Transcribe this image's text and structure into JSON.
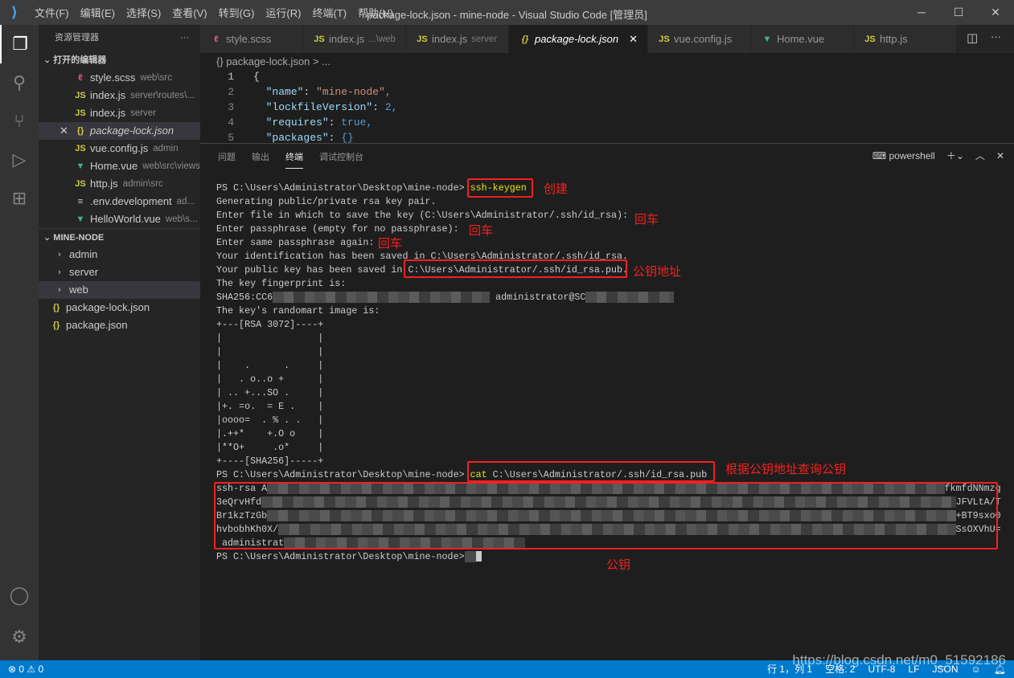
{
  "window": {
    "title": "package-lock.json - mine-node - Visual Studio Code [管理员]",
    "logo": "vscode-logo",
    "minimize": "─",
    "maximize": "☐",
    "close": "✕"
  },
  "menu": [
    "文件(F)",
    "编辑(E)",
    "选择(S)",
    "查看(V)",
    "转到(G)",
    "运行(R)",
    "终端(T)",
    "帮助(H)"
  ],
  "activity": [
    "files-icon",
    "search-icon",
    "source-control-icon",
    "run-debug-icon",
    "extensions-icon",
    "account-icon",
    "settings-gear-icon"
  ],
  "sidebar": {
    "title": "资源管理器",
    "more": "···",
    "open_editors_label": "打开的编辑器",
    "open_editors": [
      {
        "icon": "scss",
        "name": "style.scss",
        "desc": "web\\src"
      },
      {
        "icon": "js",
        "name": "index.js",
        "desc": "server\\routes\\..."
      },
      {
        "icon": "js",
        "name": "index.js",
        "desc": "server"
      },
      {
        "icon": "json",
        "name": "package-lock.json",
        "desc": "",
        "active": true
      },
      {
        "icon": "js",
        "name": "vue.config.js",
        "desc": "admin"
      },
      {
        "icon": "vue",
        "name": "Home.vue",
        "desc": "web\\src\\views"
      },
      {
        "icon": "js",
        "name": "http.js",
        "desc": "admin\\src"
      },
      {
        "icon": "text",
        "name": ".env.development",
        "desc": "ad..."
      },
      {
        "icon": "vue",
        "name": "HelloWorld.vue",
        "desc": "web\\s..."
      }
    ],
    "project_label": "MINE-NODE",
    "tree": [
      {
        "name": "admin",
        "folder": true
      },
      {
        "name": "server",
        "folder": true
      },
      {
        "name": "web",
        "folder": true,
        "selected": true
      },
      {
        "name": "package-lock.json"
      },
      {
        "name": "package.json"
      }
    ]
  },
  "tabs": [
    {
      "icon": "scss",
      "name": "style.scss",
      "desc": ""
    },
    {
      "icon": "js",
      "name": "index.js",
      "desc": "...\\web"
    },
    {
      "icon": "js",
      "name": "index.js",
      "desc": "server"
    },
    {
      "icon": "json",
      "name": "package-lock.json",
      "desc": "",
      "active": true
    },
    {
      "icon": "js",
      "name": "vue.config.js",
      "desc": ""
    },
    {
      "icon": "vue",
      "name": "Home.vue",
      "desc": ""
    },
    {
      "icon": "js",
      "name": "http.js",
      "desc": ""
    }
  ],
  "breadcrumb": "{} package-lock.json > ...",
  "editor_lines": [
    {
      "n": "1",
      "text": "{"
    },
    {
      "n": "2",
      "key": "\"name\"",
      "val": "\"mine-node\","
    },
    {
      "n": "3",
      "key": "\"lockfileVersion\"",
      "val": "2,"
    },
    {
      "n": "4",
      "key": "\"requires\"",
      "val": "true,"
    },
    {
      "n": "5",
      "key": "\"packages\"",
      "val": "{}"
    }
  ],
  "panel": {
    "tabs": [
      "问题",
      "输出",
      "终端",
      "调试控制台"
    ],
    "active_tab": "终端",
    "shell": "powershell"
  },
  "terminal": {
    "prompt": "PS C:\\Users\\Administrator\\Desktop\\mine-node>",
    "cmd1": "ssh-keygen",
    "lines1": [
      "Generating public/private rsa key pair.",
      "Enter file in which to save the key (C:\\Users\\Administrator/.ssh/id_rsa):",
      "Enter passphrase (empty for no passphrase):",
      "Enter same passphrase again:",
      "Your identification has been saved in C:\\Users\\Administrator/.ssh/id_rsa.",
      "Your public key has been saved in C:\\Users\\Administrator/.ssh/id_rsa.pub.",
      "The key fingerprint is:"
    ],
    "fingerprint_start": "SHA256:CC6",
    "fingerprint_end": " administrator@SC",
    "lines2": [
      "The key's randomart image is:",
      "+---[RSA 3072]----+",
      "|                 |",
      "|                 |",
      "|    .      .     |",
      "|   . o..o +      |",
      "| .. +...SO .     |",
      "|+. =o.  = E .    |",
      "|oooo=  . % . .   |",
      "|.++*    +.O o    |",
      "|**O+     .o*     |",
      "+----[SHA256]-----+"
    ],
    "cmd2_kw": "cat",
    "cmd2_arg": " C:\\Users\\Administrator/.ssh/id_rsa.pub",
    "key_lines": [
      [
        "ssh-rsa A",
        "fkmfdNNmzg"
      ],
      [
        "3eQrvHfd",
        "JFVLtA/T"
      ],
      [
        "Br1kzTzGb",
        "+BT9sxo0"
      ],
      [
        "hvbobhKh0X/",
        "SsOXVhU="
      ],
      [
        " administrat",
        ""
      ]
    ]
  },
  "annotations": {
    "create": "创建",
    "enter": "回车",
    "pubkey_path": "公钥地址",
    "query": "根据公钥地址查询公钥",
    "pubkey": "公钥"
  },
  "annotation_color": "#f42020",
  "status": {
    "problems": "⊗ 0 ⚠ 0",
    "position": "行 1，列 1",
    "indent": "空格: 2",
    "encoding": "UTF-8",
    "eol": "LF",
    "language": "JSON"
  },
  "watermark": "https://blog.csdn.net/m0_51592186"
}
